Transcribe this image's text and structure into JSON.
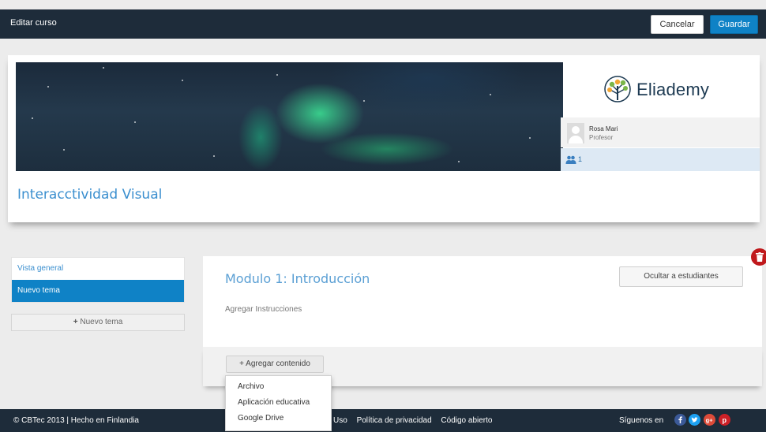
{
  "header": {
    "title": "Editar curso",
    "cancel_label": "Cancelar",
    "save_label": "Guardar"
  },
  "course": {
    "title": "Interacctividad Visual",
    "logo_text": "Eliademy",
    "teacher_name": "Rosa Mari",
    "teacher_role": "Profesor",
    "members_count": "1"
  },
  "sidebar": {
    "items": [
      {
        "label": "Vista general",
        "active": false
      },
      {
        "label": "Nuevo tema",
        "active": true
      }
    ],
    "new_topic_label": "Nuevo tema"
  },
  "module": {
    "title": "Modulo 1: Introducción",
    "instructions_placeholder": "Agregar Instrucciones",
    "hide_button_label": "Ocultar a estudiantes",
    "add_content_label": "Agregar contenido"
  },
  "add_content_menu": {
    "options": [
      "Archivo",
      "Aplicación educativa",
      "Google Drive"
    ]
  },
  "footer": {
    "copyright": "© CBTec 2013 | Hecho en Finlandia",
    "links": [
      "Uso",
      "Política de privacidad",
      "Código abierto"
    ],
    "follow_label": "Síguenos en"
  },
  "colors": {
    "topbar": "#1e2c3a",
    "accent": "#0f82c6",
    "delete": "#c0191c",
    "facebook": "#3b5998",
    "twitter": "#1da1f2",
    "googleplus": "#dd4b39",
    "pinterest": "#cb2027"
  }
}
